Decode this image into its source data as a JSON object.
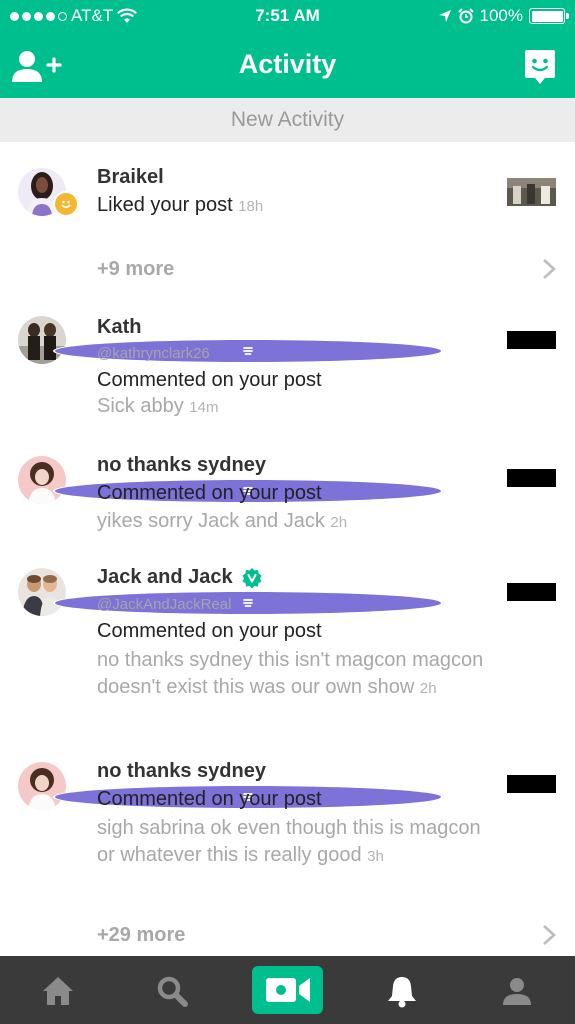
{
  "status_bar": {
    "carrier": "AT&T",
    "time": "7:51 AM",
    "battery": "100%"
  },
  "header": {
    "title": "Activity",
    "icons": [
      "add-user-icon",
      "chat-smile-icon"
    ]
  },
  "new_activity_label": "New Activity",
  "items": [
    {
      "name": "Braikel",
      "action": "Liked your post",
      "time": "18h",
      "badge": "smile-icon"
    },
    {
      "more": "+9 more"
    },
    {
      "name": "Kath",
      "handle": "@kathrynclark26",
      "action": "Commented on your post",
      "comment": "Sick abby",
      "time": "14m",
      "badge": "comment-icon"
    },
    {
      "name": "no thanks sydney",
      "action": "Commented on your post",
      "comment": "yikes sorry Jack and Jack",
      "time": "2h",
      "badge": "comment-icon"
    },
    {
      "name": "Jack and Jack",
      "verified": true,
      "handle": "@JackAndJackReal",
      "action": "Commented on your post",
      "comment": "no thanks sydney this isn't magcon magcon doesn't exist this was our own show",
      "time": "2h",
      "badge": "comment-icon"
    },
    {
      "name": "no thanks sydney",
      "action": "Commented on your post",
      "comment": "sigh sabrina ok even though this is magcon or whatever this is really good",
      "time": "3h",
      "badge": "comment-icon"
    },
    {
      "more": "+29 more"
    }
  ],
  "tabbar": {
    "tabs": [
      "home-icon",
      "search-icon",
      "video-camera-icon",
      "bell-icon",
      "profile-icon"
    ],
    "active": "bell-icon"
  },
  "colors": {
    "brand": "#00bf8f",
    "tabbar": "#3a3a3a",
    "comment_badge": "#7d72d8",
    "like_badge": "#f5b731"
  }
}
